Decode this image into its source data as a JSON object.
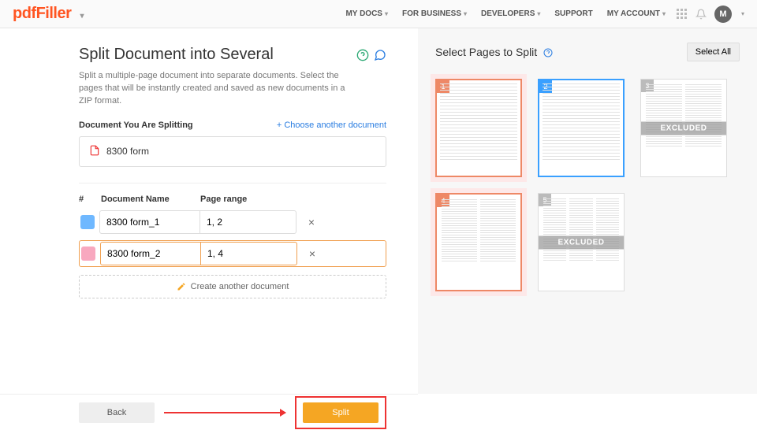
{
  "header": {
    "logo": "pdfFiller",
    "nav": {
      "mydocs": "MY DOCS",
      "business": "FOR BUSINESS",
      "developers": "DEVELOPERS",
      "support": "SUPPORT",
      "account": "MY ACCOUNT"
    },
    "avatar": "M"
  },
  "left": {
    "title": "Split Document into Several",
    "desc": "Split a multiple-page document into separate documents. Select the pages that will be instantly created and saved as new documents in a ZIP format.",
    "splitting_label": "Document You Are Splitting",
    "choose_another": "+ Choose another document",
    "doc_name": "8300 form",
    "cols": {
      "hash": "#",
      "name": "Document Name",
      "range": "Page range"
    },
    "rows": [
      {
        "name": "8300 form_1",
        "range": "1, 2"
      },
      {
        "name": "8300 form_2",
        "range": "1, 4"
      }
    ],
    "create_another": "Create another document"
  },
  "right": {
    "title": "Select Pages to Split",
    "select_all": "Select All",
    "excluded": "EXCLUDED",
    "pages": [
      "1",
      "2",
      "3",
      "4",
      "5"
    ]
  },
  "footer": {
    "back": "Back",
    "split": "Split"
  }
}
